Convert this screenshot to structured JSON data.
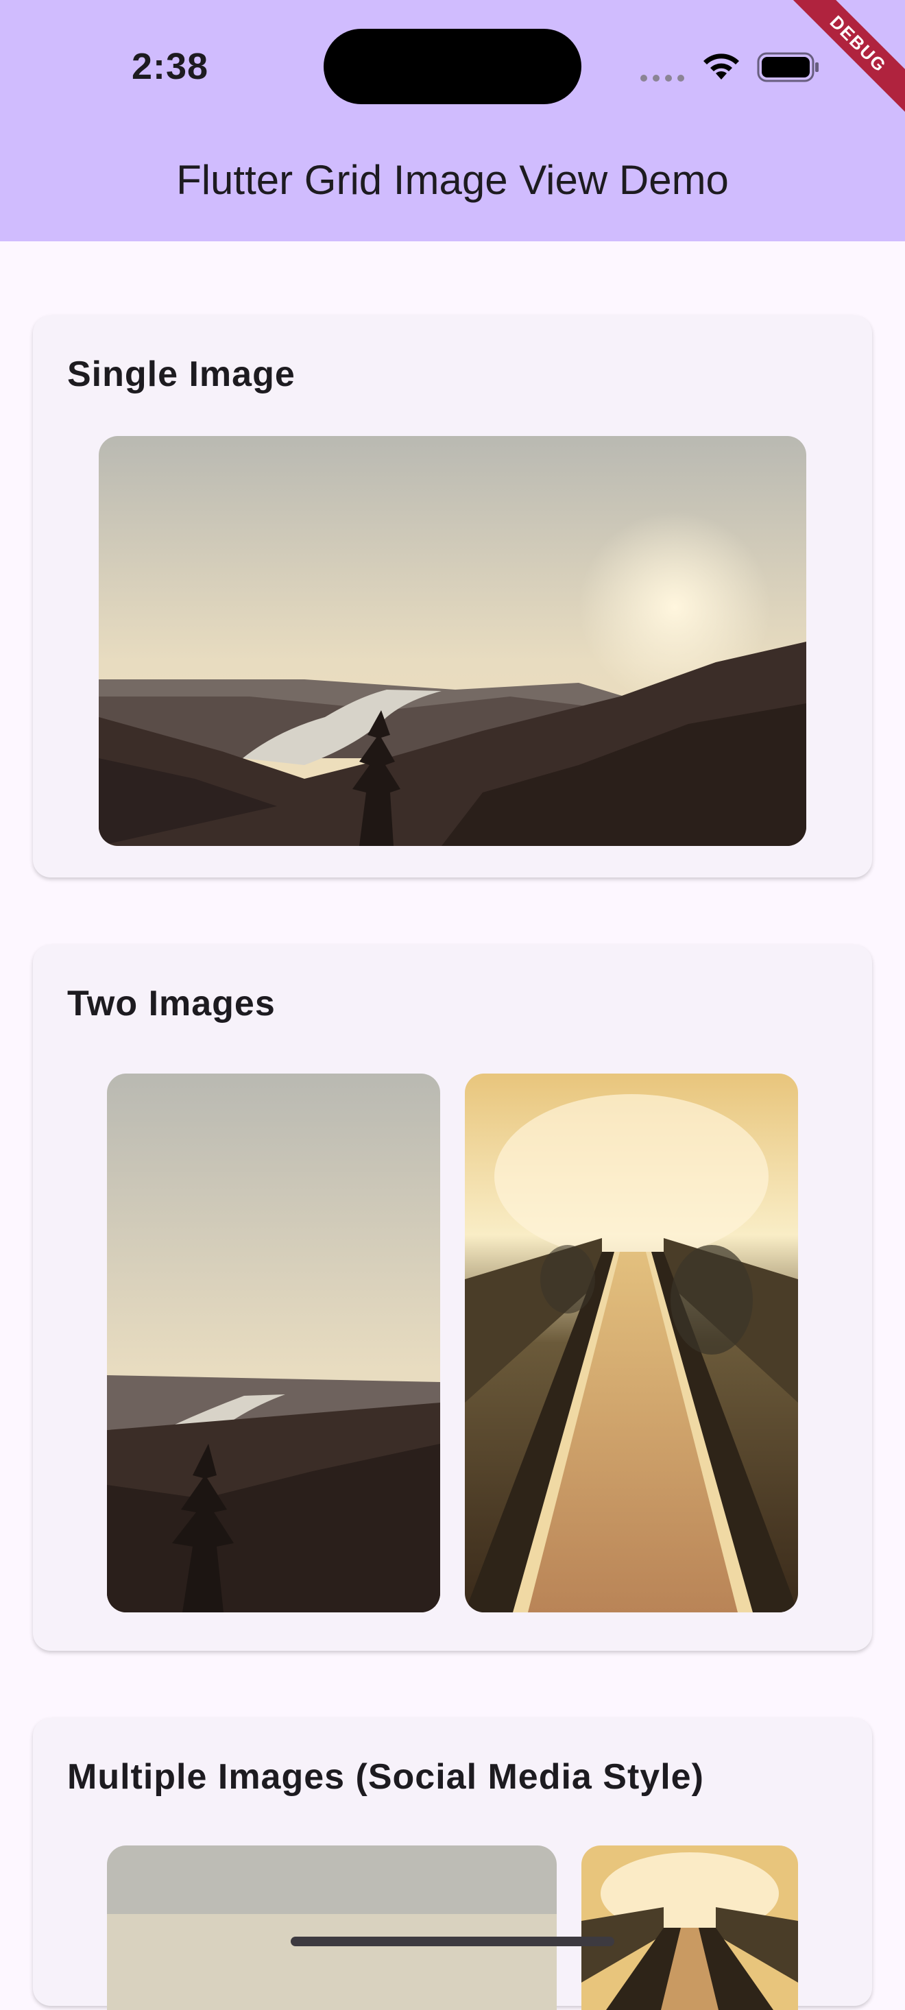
{
  "status_bar": {
    "time": "2:38"
  },
  "debug_banner": "DEBUG",
  "app_bar": {
    "title": "Flutter Grid Image View Demo"
  },
  "sections": [
    {
      "title": "Single Image",
      "images": [
        "landscape-sunset-image"
      ]
    },
    {
      "title": "Two Images",
      "images": [
        "landscape-sunset-image",
        "escalator-tunnel-image"
      ]
    },
    {
      "title": "Multiple Images (Social Media Style)",
      "images": [
        "landscape-sunset-image",
        "escalator-tunnel-image"
      ]
    }
  ],
  "colors": {
    "app_bar": "#d0bcfe",
    "background": "#fdf7ff",
    "card": "#f7f2fa",
    "debug": "#b0233e"
  }
}
